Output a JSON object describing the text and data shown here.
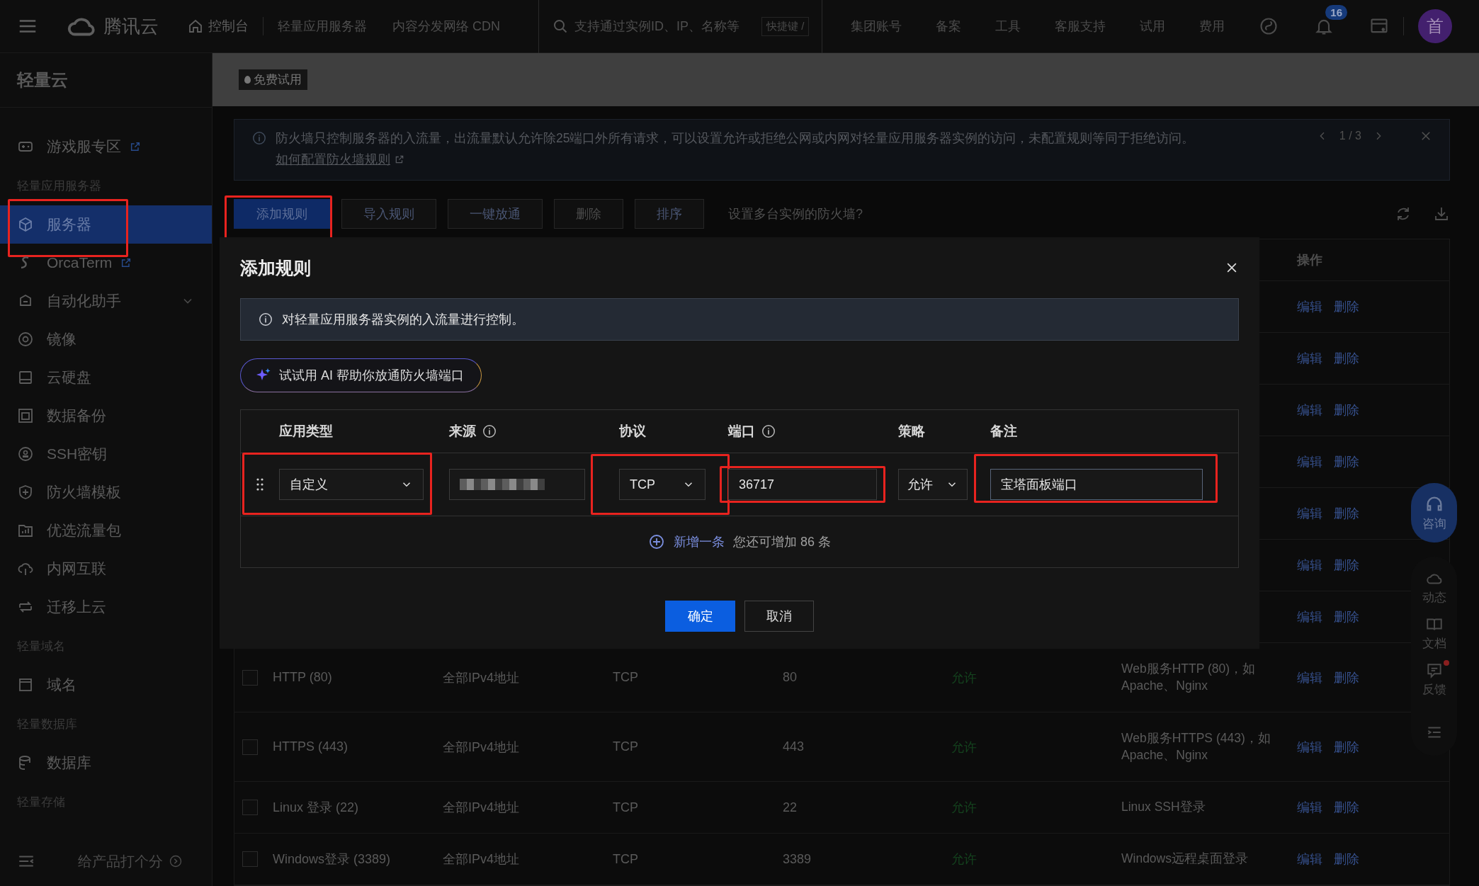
{
  "topbar": {
    "brand": "腾讯云",
    "console": "控制台",
    "links": [
      "轻量应用服务器",
      "内容分发网络 CDN"
    ],
    "search": {
      "placeholder": "支持通过实例ID、IP、名称等"
    },
    "shortcut": "快捷键 /",
    "nav": [
      "集团账号",
      "备案",
      "工具",
      "客服支持",
      "试用",
      "费用"
    ],
    "notification_count": "16",
    "avatar": "首"
  },
  "sidebar": {
    "title": "轻量云",
    "items": [
      {
        "kind": "item",
        "label": "游戏服专区",
        "external": true,
        "selected": false,
        "highlighted": false
      },
      {
        "kind": "section",
        "label": "轻量应用服务器"
      },
      {
        "kind": "item",
        "label": "服务器",
        "selected": true,
        "highlighted": true
      },
      {
        "kind": "item",
        "label": "OrcaTerm",
        "external": true,
        "selected": false,
        "highlighted": false
      },
      {
        "kind": "item",
        "label": "自动化助手",
        "expanded": false,
        "selected": false,
        "highlighted": false
      },
      {
        "kind": "item",
        "label": "镜像",
        "selected": false,
        "highlighted": false
      },
      {
        "kind": "item",
        "label": "云硬盘",
        "selected": false,
        "highlighted": false
      },
      {
        "kind": "item",
        "label": "数据备份",
        "selected": false,
        "highlighted": false
      },
      {
        "kind": "item",
        "label": "SSH密钥",
        "selected": false,
        "highlighted": false
      },
      {
        "kind": "item",
        "label": "防火墙模板",
        "selected": false,
        "highlighted": false
      },
      {
        "kind": "item",
        "label": "优选流量包",
        "selected": false,
        "highlighted": false
      },
      {
        "kind": "item",
        "label": "内网互联",
        "selected": false,
        "highlighted": false
      },
      {
        "kind": "item",
        "label": "迁移上云",
        "selected": false,
        "highlighted": false
      },
      {
        "kind": "section",
        "label": "轻量域名"
      },
      {
        "kind": "item",
        "label": "域名",
        "selected": false,
        "highlighted": false
      },
      {
        "kind": "section",
        "label": "轻量数据库"
      },
      {
        "kind": "item",
        "label": "数据库",
        "selected": false,
        "highlighted": false
      },
      {
        "kind": "section",
        "label": "轻量存储"
      }
    ],
    "footer": "给产品打个分"
  },
  "banner": {
    "tag": "免费试用"
  },
  "notice": {
    "text": "防火墙只控制服务器的入流量，出流量默认允许除25端口外所有请求，可以设置允许或拒绝公网或内网对轻量应用服务器实例的访问，未配置规则等同于拒绝访问。",
    "link": "如何配置防火墙规则",
    "pager": "1 / 3"
  },
  "toolbar": {
    "buttons": [
      {
        "label": "添加规则",
        "kind": "primary",
        "disabled": false,
        "highlighted": true
      },
      {
        "label": "导入规则",
        "kind": "default",
        "disabled": false,
        "highlighted": false
      },
      {
        "label": "一键放通",
        "kind": "default",
        "disabled": false,
        "highlighted": false
      },
      {
        "label": "删除",
        "kind": "default",
        "disabled": true,
        "highlighted": false
      },
      {
        "label": "排序",
        "kind": "default",
        "disabled": false,
        "highlighted": false
      }
    ],
    "help": "设置多台实例的防火墙?"
  },
  "table": {
    "header": {
      "actions": "操作"
    },
    "rows": [
      {
        "actions": [
          "编辑",
          "删除"
        ]
      },
      {
        "actions": [
          "编辑",
          "删除"
        ]
      },
      {
        "actions": [
          "编辑",
          "删除"
        ]
      },
      {
        "actions": [
          "编辑",
          "删除"
        ]
      },
      {
        "actions": [
          "编辑",
          "删除"
        ]
      },
      {
        "actions": [
          "编辑",
          "删除"
        ]
      },
      {
        "actions": [
          "编辑",
          "删除"
        ]
      },
      {
        "checked": false,
        "cells": [
          "HTTP (80)",
          "全部IPv4地址",
          "TCP",
          "80",
          "允许",
          "Web服务HTTP (80)，如 Apache、Nginx"
        ],
        "actions": [
          "编辑",
          "删除"
        ]
      },
      {
        "checked": false,
        "cells": [
          "HTTPS (443)",
          "全部IPv4地址",
          "TCP",
          "443",
          "允许",
          "Web服务HTTPS (443)，如 Apache、Nginx"
        ],
        "actions": [
          "编辑",
          "删除"
        ]
      },
      {
        "checked": false,
        "cells": [
          "Linux 登录 (22)",
          "全部IPv4地址",
          "TCP",
          "22",
          "允许",
          "Linux SSH登录"
        ],
        "actions": [
          "编辑",
          "删除"
        ]
      },
      {
        "checked": false,
        "cells": [
          "Windows登录 (3389)",
          "全部IPv4地址",
          "TCP",
          "3389",
          "允许",
          "Windows远程桌面登录"
        ],
        "actions": [
          "编辑",
          "删除"
        ]
      }
    ]
  },
  "dialog": {
    "title": "添加规则",
    "info": "对轻量应用服务器实例的入流量进行控制。",
    "ai_button": "试试用 AI 帮助你放通防火墙端口",
    "columns": [
      {
        "label": "应用类型",
        "hint": false,
        "highlighted": true
      },
      {
        "label": "来源",
        "hint": true,
        "highlighted": false
      },
      {
        "label": "协议",
        "hint": false,
        "highlighted": true
      },
      {
        "label": "端口",
        "hint": true,
        "highlighted": true
      },
      {
        "label": "策略",
        "hint": false,
        "highlighted": false
      },
      {
        "label": "备注",
        "hint": false,
        "highlighted": true
      }
    ],
    "rule": {
      "app_type": "自定义",
      "source_masked": true,
      "protocol": "TCP",
      "port": "36717",
      "policy": "允许",
      "remark": "宝塔面板端口"
    },
    "add_link": "新增一条",
    "quota": "您还可增加 86 条",
    "confirm": "确定",
    "cancel": "取消"
  },
  "float_panel": {
    "consult": "咨询",
    "items": [
      {
        "label": "动态",
        "unread": false
      },
      {
        "label": "文档",
        "unread": false
      },
      {
        "label": "反馈",
        "unread": true
      }
    ]
  }
}
